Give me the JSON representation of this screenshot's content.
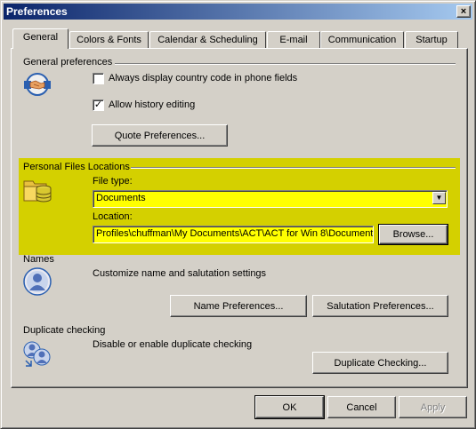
{
  "window": {
    "title": "Preferences",
    "close_label": "×"
  },
  "tabs": [
    {
      "label": "General",
      "active": true
    },
    {
      "label": "Colors & Fonts"
    },
    {
      "label": "Calendar & Scheduling"
    },
    {
      "label": "E-mail"
    },
    {
      "label": "Communication"
    },
    {
      "label": "Startup"
    }
  ],
  "general": {
    "heading": "General preferences",
    "country_code_label": "Always display country code in phone fields",
    "country_code_checked": false,
    "history_label": "Allow history editing",
    "history_checked": true,
    "checkmark": "✓",
    "quote_button": "Quote Preferences..."
  },
  "personal_files": {
    "heading": "Personal Files Locations",
    "file_type_label": "File type:",
    "file_type_value": "Documents",
    "dropdown_arrow": "▼",
    "location_label": "Location:",
    "location_value": "Profiles\\chuffman\\My Documents\\ACT\\ACT for Win 8\\Document",
    "browse_button": "Browse...",
    "highlight_color": "#d4d000",
    "field_color": "#ffff00"
  },
  "names": {
    "heading": "Names",
    "description": "Customize name and salutation settings",
    "name_button": "Name Preferences...",
    "salutation_button": "Salutation Preferences..."
  },
  "duplicates": {
    "heading": "Duplicate checking",
    "description": "Disable or enable duplicate checking",
    "button": "Duplicate Checking..."
  },
  "footer": {
    "ok": "OK",
    "cancel": "Cancel",
    "apply": "Apply",
    "apply_enabled": false
  }
}
